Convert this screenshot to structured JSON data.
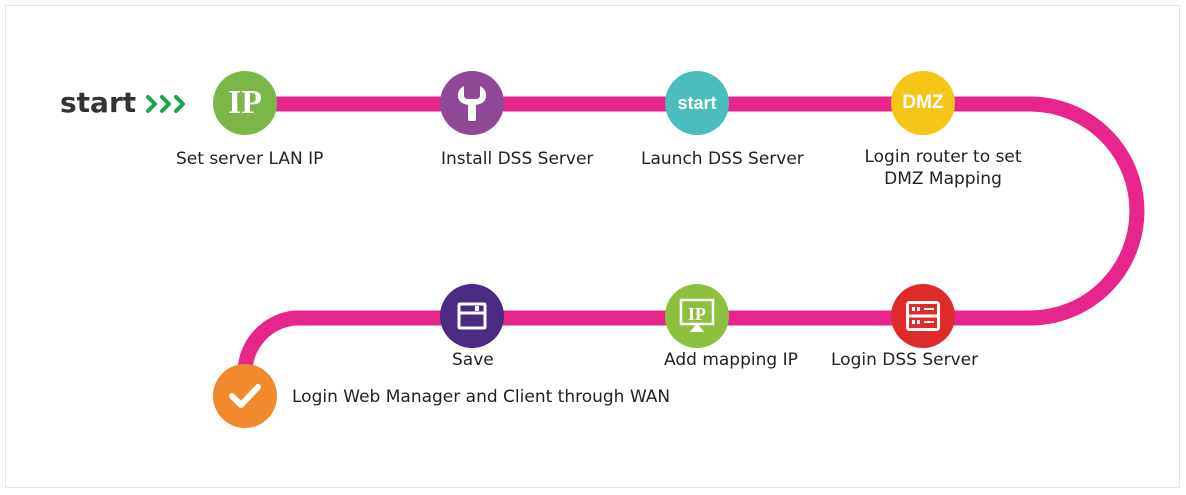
{
  "start_label": "start",
  "steps": [
    {
      "label": "Set server LAN IP",
      "icon": "ip-icon",
      "text": "IP",
      "color": "#7ab648"
    },
    {
      "label": "Install DSS Server",
      "icon": "wrench-icon",
      "color": "#8e4895"
    },
    {
      "label": "Launch DSS Server",
      "icon": "start-icon",
      "text": "start",
      "color": "#4bbdbd"
    },
    {
      "label_line1": "Login router to set",
      "label_line2": "DMZ Mapping",
      "icon": "dmz-icon",
      "text": "DMZ",
      "color": "#f5c518"
    },
    {
      "label": "Login DSS Server",
      "icon": "server-icon",
      "color": "#e02b2b"
    },
    {
      "label": "Add mapping IP",
      "icon": "monitor-ip-icon",
      "text": "IP",
      "color": "#8cc03f"
    },
    {
      "label": "Save",
      "icon": "save-icon",
      "color": "#4a2a82"
    },
    {
      "label": "Login Web Manager and Client through WAN",
      "icon": "check-icon",
      "color": "#f08a2c"
    }
  ],
  "colors": {
    "path": "#e8258b",
    "arrows": "#1aa64a"
  }
}
